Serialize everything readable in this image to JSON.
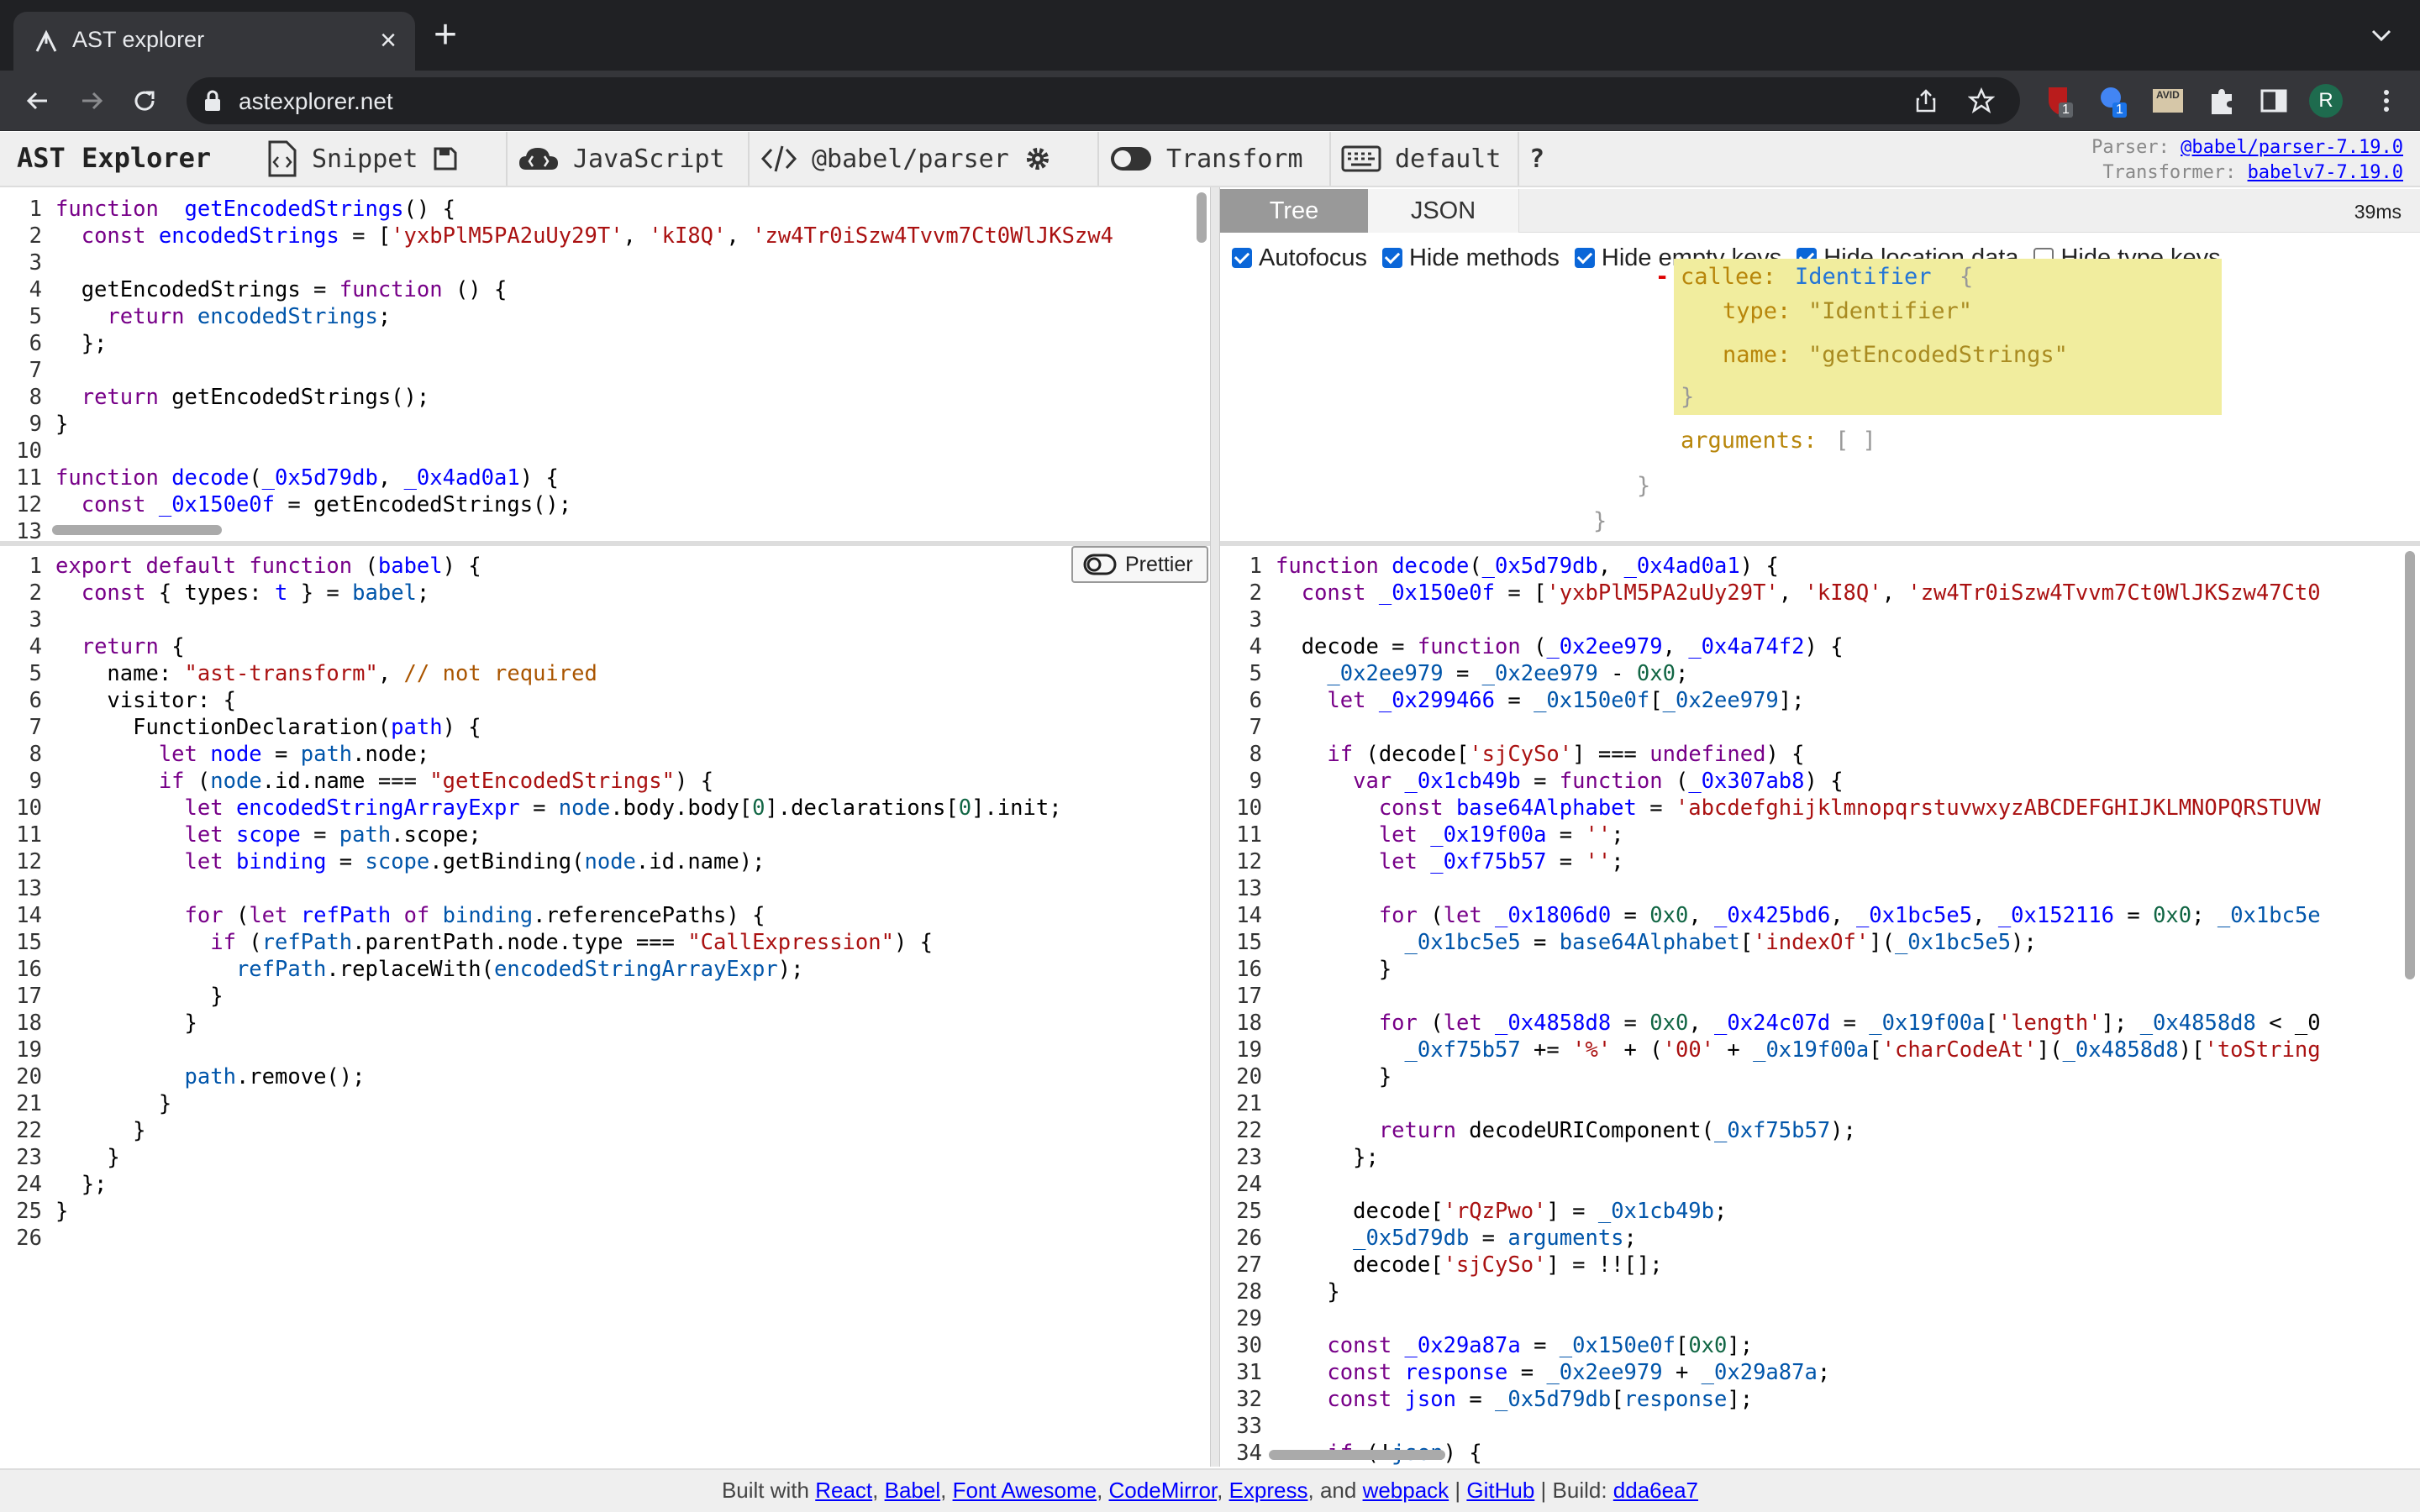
{
  "browser": {
    "tab_title": "AST explorer",
    "url": "astexplorer.net",
    "ext_badge_1": "1",
    "ext_badge_2": "1",
    "ext_label_3": "AVID",
    "avatar_letter": "R"
  },
  "app": {
    "title": "AST Explorer",
    "menu_snippet": "Snippet",
    "menu_language": "JavaScript",
    "menu_parser": "@babel/parser",
    "menu_transform": "Transform",
    "menu_keymap": "default",
    "help": "?",
    "parser_label": "Parser:",
    "parser_value": "@babel/parser-7.19.0",
    "transformer_label": "Transformer:",
    "transformer_value": "babelv7-7.19.0"
  },
  "ast": {
    "tab_tree": "Tree",
    "tab_json": "JSON",
    "time": "39ms",
    "options": [
      {
        "label": "Autofocus",
        "checked": true
      },
      {
        "label": "Hide methods",
        "checked": true
      },
      {
        "label": "Hide empty keys",
        "checked": true
      },
      {
        "label": "Hide location data",
        "checked": true
      },
      {
        "label": "Hide type keys",
        "checked": false
      }
    ],
    "node_minus": "-",
    "node_key": "callee:",
    "node_type": "Identifier",
    "node_open": "{",
    "type_key": "type:",
    "type_val": "\"Identifier\"",
    "name_key": "name:",
    "name_val": "\"getEncodedStrings\"",
    "node_close": "}",
    "args_key": "arguments:",
    "args_val": "[ ]",
    "close_1": "}",
    "close_2": "}"
  },
  "prettier_label": "Prettier",
  "footer": {
    "built_with": "Built with",
    "react": "React",
    "babel": "Babel",
    "fontawesome": "Font Awesome",
    "codemirror": "CodeMirror",
    "express": "Express",
    "and": ", and",
    "webpack": "webpack",
    "github": "GitHub",
    "build_label": "| Build:",
    "build": "dda6ea7"
  },
  "source_code": [
    [
      [
        "kw",
        "function"
      ],
      [
        "",
        "  "
      ],
      [
        "def",
        "getEncodedStrings"
      ],
      [
        "",
        "() {"
      ]
    ],
    [
      [
        "",
        "  "
      ],
      [
        "kw",
        "const"
      ],
      [
        "",
        ""
      ],
      [
        "def",
        "encodedStrings"
      ],
      [
        "",
        " = ["
      ],
      [
        "str",
        "'yxbPlM5PA2uUy29T'"
      ],
      [
        "",
        ", "
      ],
      [
        "str",
        "'kI8Q'"
      ],
      [
        "",
        ", "
      ],
      [
        "str",
        "'zw4Tr0iSzw4Tvvm7Ct0WlJKSzw4"
      ]
    ],
    [],
    [
      [
        "",
        "  getEncodedStrings = "
      ],
      [
        "kw",
        "function"
      ],
      [
        "",
        " () {"
      ]
    ],
    [
      [
        "",
        "    "
      ],
      [
        "kw",
        "return"
      ],
      [
        "",
        " "
      ],
      [
        "var2",
        "encodedStrings"
      ],
      [
        "",
        ";"
      ]
    ],
    [
      [
        "",
        "  };"
      ]
    ],
    [],
    [
      [
        "",
        "  "
      ],
      [
        "kw",
        "return"
      ],
      [
        "",
        " getEncodedStrings();"
      ]
    ],
    [
      [
        "",
        "}"
      ]
    ],
    [],
    [
      [
        "kw",
        "function"
      ],
      [
        "",
        " "
      ],
      [
        "def",
        "decode"
      ],
      [
        "",
        "("
      ],
      [
        "def",
        "_0x5d79db"
      ],
      [
        "",
        ", "
      ],
      [
        "def",
        "_0x4ad0a1"
      ],
      [
        "",
        ") {"
      ]
    ],
    [
      [
        "",
        "  "
      ],
      [
        "kw",
        "const"
      ],
      [
        "",
        " "
      ],
      [
        "def",
        "_0x150e0f"
      ],
      [
        "",
        " = getEncodedStrings();"
      ]
    ],
    []
  ],
  "transform_code": [
    [
      [
        "kw",
        "export"
      ],
      [
        "",
        " "
      ],
      [
        "kw",
        "default"
      ],
      [
        "",
        " "
      ],
      [
        "kw",
        "function"
      ],
      [
        "",
        " ("
      ],
      [
        "def",
        "babel"
      ],
      [
        "",
        ") {"
      ]
    ],
    [
      [
        "",
        "  "
      ],
      [
        "kw",
        "const"
      ],
      [
        "",
        " { types: "
      ],
      [
        "def",
        "t"
      ],
      [
        "",
        " } = "
      ],
      [
        "var2",
        "babel"
      ],
      [
        "",
        ";"
      ]
    ],
    [],
    [
      [
        "",
        "  "
      ],
      [
        "kw",
        "return"
      ],
      [
        "",
        " {"
      ]
    ],
    [
      [
        "",
        "    name: "
      ],
      [
        "str",
        "\"ast-transform\""
      ],
      [
        "",
        ", "
      ],
      [
        "com",
        "// not required"
      ]
    ],
    [
      [
        "",
        "    visitor: {"
      ]
    ],
    [
      [
        "",
        "      FunctionDeclaration("
      ],
      [
        "def",
        "path"
      ],
      [
        "",
        ") {"
      ]
    ],
    [
      [
        "",
        "        "
      ],
      [
        "kw",
        "let"
      ],
      [
        "",
        " "
      ],
      [
        "def",
        "node"
      ],
      [
        "",
        " = "
      ],
      [
        "var2",
        "path"
      ],
      [
        "",
        ".node;"
      ]
    ],
    [
      [
        "",
        "        "
      ],
      [
        "kw",
        "if"
      ],
      [
        "",
        " ("
      ],
      [
        "var2",
        "node"
      ],
      [
        "",
        ".id.name === "
      ],
      [
        "str",
        "\"getEncodedStrings\""
      ],
      [
        "",
        ") {"
      ]
    ],
    [
      [
        "",
        "          "
      ],
      [
        "kw",
        "let"
      ],
      [
        "",
        " "
      ],
      [
        "def",
        "encodedStringArrayExpr"
      ],
      [
        "",
        " = "
      ],
      [
        "var2",
        "node"
      ],
      [
        "",
        ".body.body["
      ],
      [
        "num",
        "0"
      ],
      [
        "",
        "].declarations["
      ],
      [
        "num",
        "0"
      ],
      [
        "",
        "].init;"
      ]
    ],
    [
      [
        "",
        "          "
      ],
      [
        "kw",
        "let"
      ],
      [
        "",
        " "
      ],
      [
        "def",
        "scope"
      ],
      [
        "",
        " = "
      ],
      [
        "var2",
        "path"
      ],
      [
        "",
        ".scope;"
      ]
    ],
    [
      [
        "",
        "          "
      ],
      [
        "kw",
        "let"
      ],
      [
        "",
        " "
      ],
      [
        "def",
        "binding"
      ],
      [
        "",
        " = "
      ],
      [
        "var2",
        "scope"
      ],
      [
        "",
        ".getBinding("
      ],
      [
        "var2",
        "node"
      ],
      [
        "",
        ".id.name);"
      ]
    ],
    [],
    [
      [
        "",
        "          "
      ],
      [
        "kw",
        "for"
      ],
      [
        "",
        " ("
      ],
      [
        "kw",
        "let"
      ],
      [
        "",
        " "
      ],
      [
        "def",
        "refPath"
      ],
      [
        "",
        " "
      ],
      [
        "kw",
        "of"
      ],
      [
        "",
        " "
      ],
      [
        "var2",
        "binding"
      ],
      [
        "",
        ".referencePaths) {"
      ]
    ],
    [
      [
        "",
        "            "
      ],
      [
        "kw",
        "if"
      ],
      [
        "",
        " ("
      ],
      [
        "var2",
        "refPath"
      ],
      [
        "",
        ".parentPath.node.type === "
      ],
      [
        "str",
        "\"CallExpression\""
      ],
      [
        "",
        ") {"
      ]
    ],
    [
      [
        "",
        "              "
      ],
      [
        "var2",
        "refPath"
      ],
      [
        "",
        ".replaceWith("
      ],
      [
        "var2",
        "encodedStringArrayExpr"
      ],
      [
        "",
        ");"
      ]
    ],
    [
      [
        "",
        "            }"
      ]
    ],
    [
      [
        "",
        "          }"
      ]
    ],
    [],
    [
      [
        "",
        "          "
      ],
      [
        "var2",
        "path"
      ],
      [
        "",
        ".remove();"
      ]
    ],
    [
      [
        "",
        "        }"
      ]
    ],
    [
      [
        "",
        "      }"
      ]
    ],
    [
      [
        "",
        "    }"
      ]
    ],
    [
      [
        "",
        "  };"
      ]
    ],
    [
      [
        "",
        "}"
      ]
    ],
    []
  ],
  "output_code": [
    [
      [
        "kw",
        "function"
      ],
      [
        "",
        " "
      ],
      [
        "def",
        "decode"
      ],
      [
        "",
        "("
      ],
      [
        "def",
        "_0x5d79db"
      ],
      [
        "",
        ", "
      ],
      [
        "def",
        "_0x4ad0a1"
      ],
      [
        "",
        ") {"
      ]
    ],
    [
      [
        "",
        "  "
      ],
      [
        "kw",
        "const"
      ],
      [
        "",
        " "
      ],
      [
        "def",
        "_0x150e0f"
      ],
      [
        "",
        " = ["
      ],
      [
        "str",
        "'yxbPlM5PA2uUy29T'"
      ],
      [
        "",
        ", "
      ],
      [
        "str",
        "'kI8Q'"
      ],
      [
        "",
        ", "
      ],
      [
        "str",
        "'zw4Tr0iSzw4Tvvm7Ct0WlJKSzw47Ct0"
      ]
    ],
    [],
    [
      [
        "",
        "  decode = "
      ],
      [
        "kw",
        "function"
      ],
      [
        "",
        " ("
      ],
      [
        "def",
        "_0x2ee979"
      ],
      [
        "",
        ", "
      ],
      [
        "def",
        "_0x4a74f2"
      ],
      [
        "",
        ") {"
      ]
    ],
    [
      [
        "",
        "    "
      ],
      [
        "var2",
        "_0x2ee979"
      ],
      [
        "",
        " = "
      ],
      [
        "var2",
        "_0x2ee979"
      ],
      [
        "",
        " - "
      ],
      [
        "num",
        "0x0"
      ],
      [
        "",
        ";"
      ]
    ],
    [
      [
        "",
        "    "
      ],
      [
        "kw",
        "let"
      ],
      [
        "",
        " "
      ],
      [
        "def",
        "_0x299466"
      ],
      [
        "",
        " = "
      ],
      [
        "var2",
        "_0x150e0f"
      ],
      [
        "",
        "["
      ],
      [
        "var2",
        "_0x2ee979"
      ],
      [
        "",
        "];"
      ]
    ],
    [],
    [
      [
        "",
        "    "
      ],
      [
        "kw",
        "if"
      ],
      [
        "",
        " (decode["
      ],
      [
        "str",
        "'sjCySo'"
      ],
      [
        "",
        "] === "
      ],
      [
        "kw",
        "undefined"
      ],
      [
        "",
        ") {"
      ]
    ],
    [
      [
        "",
        "      "
      ],
      [
        "kw",
        "var"
      ],
      [
        "",
        " "
      ],
      [
        "def",
        "_0x1cb49b"
      ],
      [
        "",
        " = "
      ],
      [
        "kw",
        "function"
      ],
      [
        "",
        " ("
      ],
      [
        "def",
        "_0x307ab8"
      ],
      [
        "",
        ") {"
      ]
    ],
    [
      [
        "",
        "        "
      ],
      [
        "kw",
        "const"
      ],
      [
        "",
        " "
      ],
      [
        "def",
        "base64Alphabet"
      ],
      [
        "",
        " = "
      ],
      [
        "str",
        "'abcdefghijklmnopqrstuvwxyzABCDEFGHIJKLMNOPQRSTUVW"
      ]
    ],
    [
      [
        "",
        "        "
      ],
      [
        "kw",
        "let"
      ],
      [
        "",
        " "
      ],
      [
        "def",
        "_0x19f00a"
      ],
      [
        "",
        " = "
      ],
      [
        "str",
        "''"
      ],
      [
        "",
        ";"
      ]
    ],
    [
      [
        "",
        "        "
      ],
      [
        "kw",
        "let"
      ],
      [
        "",
        " "
      ],
      [
        "def",
        "_0xf75b57"
      ],
      [
        "",
        " = "
      ],
      [
        "str",
        "''"
      ],
      [
        "",
        ";"
      ]
    ],
    [],
    [
      [
        "",
        "        "
      ],
      [
        "kw",
        "for"
      ],
      [
        "",
        " ("
      ],
      [
        "kw",
        "let"
      ],
      [
        "",
        " "
      ],
      [
        "def",
        "_0x1806d0"
      ],
      [
        "",
        " = "
      ],
      [
        "num",
        "0x0"
      ],
      [
        "",
        ", "
      ],
      [
        "def",
        "_0x425bd6"
      ],
      [
        "",
        ", "
      ],
      [
        "def",
        "_0x1bc5e5"
      ],
      [
        "",
        ", "
      ],
      [
        "def",
        "_0x152116"
      ],
      [
        "",
        " = "
      ],
      [
        "num",
        "0x0"
      ],
      [
        "",
        "; "
      ],
      [
        "var2",
        "_0x1bc5e"
      ]
    ],
    [
      [
        "",
        "          "
      ],
      [
        "var2",
        "_0x1bc5e5"
      ],
      [
        "",
        " = "
      ],
      [
        "var2",
        "base64Alphabet"
      ],
      [
        "",
        "["
      ],
      [
        "str",
        "'indexOf'"
      ],
      [
        "",
        "]("
      ],
      [
        "var2",
        "_0x1bc5e5"
      ],
      [
        "",
        ");"
      ]
    ],
    [
      [
        "",
        "        }"
      ]
    ],
    [],
    [
      [
        "",
        "        "
      ],
      [
        "kw",
        "for"
      ],
      [
        "",
        " ("
      ],
      [
        "kw",
        "let"
      ],
      [
        "",
        " "
      ],
      [
        "def",
        "_0x4858d8"
      ],
      [
        "",
        " = "
      ],
      [
        "num",
        "0x0"
      ],
      [
        "",
        ", "
      ],
      [
        "def",
        "_0x24c07d"
      ],
      [
        "",
        " = "
      ],
      [
        "var2",
        "_0x19f00a"
      ],
      [
        "",
        "["
      ],
      [
        "str",
        "'length'"
      ],
      [
        "",
        "]; "
      ],
      [
        "var2",
        "_0x4858d8"
      ],
      [
        "",
        " < _0"
      ]
    ],
    [
      [
        "",
        "          "
      ],
      [
        "var2",
        "_0xf75b57"
      ],
      [
        "",
        " += "
      ],
      [
        "str",
        "'%'"
      ],
      [
        "",
        " + ("
      ],
      [
        "str",
        "'00'"
      ],
      [
        "",
        " + "
      ],
      [
        "var2",
        "_0x19f00a"
      ],
      [
        "",
        "["
      ],
      [
        "str",
        "'charCodeAt'"
      ],
      [
        "",
        "]("
      ],
      [
        "var2",
        "_0x4858d8"
      ],
      [
        "",
        ")["
      ],
      [
        "str",
        "'toString"
      ]
    ],
    [
      [
        "",
        "        }"
      ]
    ],
    [],
    [
      [
        "",
        "        "
      ],
      [
        "kw",
        "return"
      ],
      [
        "",
        " decodeURIComponent("
      ],
      [
        "var2",
        "_0xf75b57"
      ],
      [
        "",
        ");"
      ]
    ],
    [
      [
        "",
        "      };"
      ]
    ],
    [],
    [
      [
        "",
        "      decode["
      ],
      [
        "str",
        "'rQzPwo'"
      ],
      [
        "",
        "] = "
      ],
      [
        "var2",
        "_0x1cb49b"
      ],
      [
        "",
        ";"
      ]
    ],
    [
      [
        "",
        "      "
      ],
      [
        "var2",
        "_0x5d79db"
      ],
      [
        "",
        " = "
      ],
      [
        "var2",
        "arguments"
      ],
      [
        "",
        ";"
      ]
    ],
    [
      [
        "",
        "      decode["
      ],
      [
        "str",
        "'sjCySo'"
      ],
      [
        "",
        "] = !![];"
      ]
    ],
    [
      [
        "",
        "    }"
      ]
    ],
    [],
    [
      [
        "",
        "    "
      ],
      [
        "kw",
        "const"
      ],
      [
        "",
        " "
      ],
      [
        "def",
        "_0x29a87a"
      ],
      [
        "",
        " = "
      ],
      [
        "var2",
        "_0x150e0f"
      ],
      [
        "",
        "["
      ],
      [
        "num",
        "0x0"
      ],
      [
        "",
        "];"
      ]
    ],
    [
      [
        "",
        "    "
      ],
      [
        "kw",
        "const"
      ],
      [
        "",
        " "
      ],
      [
        "def",
        "response"
      ],
      [
        "",
        " = "
      ],
      [
        "var2",
        "_0x2ee979"
      ],
      [
        "",
        " + "
      ],
      [
        "var2",
        "_0x29a87a"
      ],
      [
        "",
        ";"
      ]
    ],
    [
      [
        "",
        "    "
      ],
      [
        "kw",
        "const"
      ],
      [
        "",
        " "
      ],
      [
        "def",
        "json"
      ],
      [
        "",
        " = "
      ],
      [
        "var2",
        "_0x5d79db"
      ],
      [
        "",
        "["
      ],
      [
        "var2",
        "response"
      ],
      [
        "",
        "];"
      ]
    ],
    [],
    [
      [
        "",
        "    "
      ],
      [
        "kw",
        "if"
      ],
      [
        "",
        " (!"
      ],
      [
        "var2",
        "json"
      ],
      [
        "",
        ") {"
      ]
    ]
  ]
}
